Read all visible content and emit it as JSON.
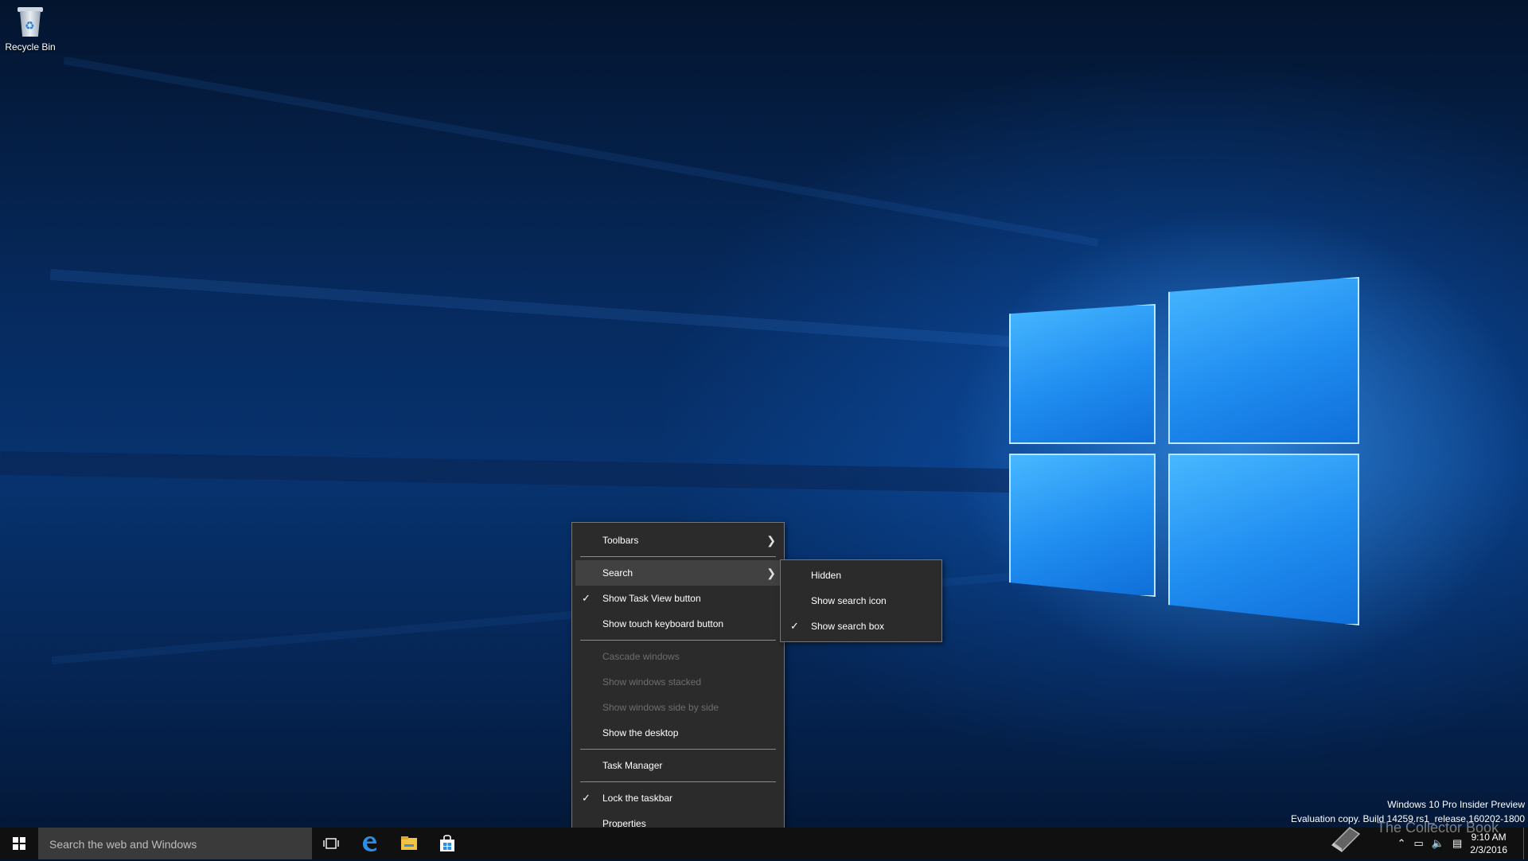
{
  "desktop": {
    "icons": [
      {
        "label": "Recycle Bin",
        "icon": "recycle-bin-icon"
      }
    ]
  },
  "context_menu": {
    "items": [
      {
        "label": "Toolbars",
        "has_submenu": true
      },
      {
        "label": "Search",
        "has_submenu": true,
        "highlighted": true
      },
      {
        "label": "Show Task View button",
        "checked": true
      },
      {
        "label": "Show touch keyboard button"
      },
      {
        "label": "Cascade windows",
        "disabled": true
      },
      {
        "label": "Show windows stacked",
        "disabled": true
      },
      {
        "label": "Show windows side by side",
        "disabled": true
      },
      {
        "label": "Show the desktop"
      },
      {
        "label": "Task Manager"
      },
      {
        "label": "Lock the taskbar",
        "checked": true
      },
      {
        "label": "Properties"
      }
    ],
    "submenu": {
      "items": [
        {
          "label": "Hidden"
        },
        {
          "label": "Show search icon"
        },
        {
          "label": "Show search box",
          "checked": true
        }
      ]
    },
    "check_glyph": "✓",
    "arrow_glyph": "❯"
  },
  "watermark": {
    "line1": "Windows 10 Pro Insider Preview",
    "line2": "Evaluation copy. Build 14259.rs1_release.160202-1800"
  },
  "overlay_logo": {
    "text": "The Collector Book"
  },
  "taskbar": {
    "search_placeholder": "Search the web and Windows",
    "pinned": [
      "task-view-icon",
      "edge-icon",
      "file-explorer-icon",
      "store-icon"
    ],
    "clock": {
      "time": "9:10 AM",
      "date": "2/3/2016"
    }
  },
  "colors": {
    "taskbar": "#101010",
    "menu_bg": "#2b2b2b",
    "menu_highlight": "#414141",
    "accent_blue": "#1f8cf0"
  }
}
